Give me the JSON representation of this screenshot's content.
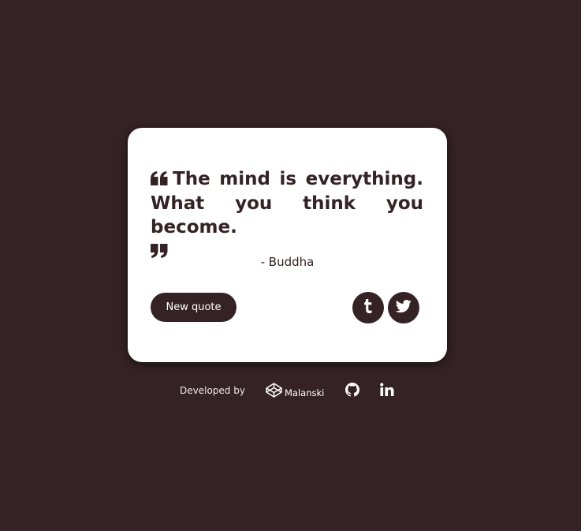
{
  "quote": {
    "text": "The mind is everything. What you think you become.",
    "author": "- Buddha",
    "open_icon": "quote-left-icon",
    "close_icon": "quote-right-icon"
  },
  "actions": {
    "new_quote_label": "New quote",
    "tumblr_icon": "tumblr-icon",
    "twitter_icon": "twitter-icon"
  },
  "footer": {
    "developed_by_label": "Developed by",
    "codepen_icon": "codepen-icon",
    "codepen_name": "Malanski",
    "github_icon": "github-icon",
    "linkedin_icon": "linkedin-icon"
  },
  "colors": {
    "background": "#342224",
    "card": "#ffffff",
    "accent": "#342224"
  }
}
